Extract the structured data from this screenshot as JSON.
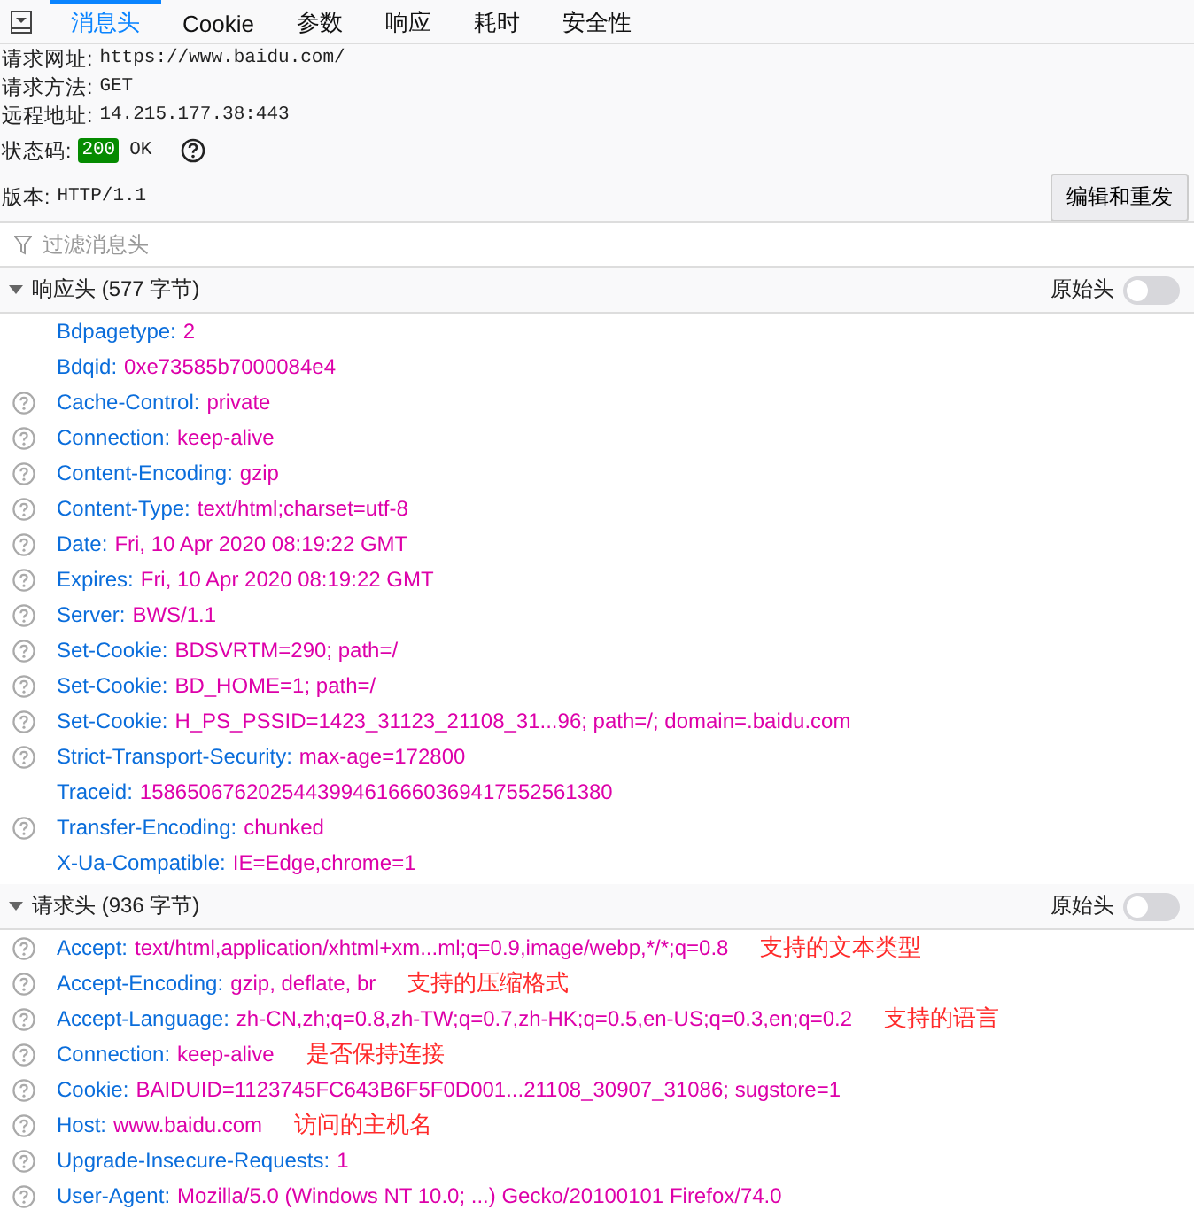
{
  "tabs": [
    {
      "label": "消息头",
      "selected": true
    },
    {
      "label": "Cookie",
      "selected": false
    },
    {
      "label": "参数",
      "selected": false
    },
    {
      "label": "响应",
      "selected": false
    },
    {
      "label": "耗时",
      "selected": false
    },
    {
      "label": "安全性",
      "selected": false
    }
  ],
  "summary": [
    {
      "label": "请求网址:",
      "value": "https://www.baidu.com/"
    },
    {
      "label": "请求方法:",
      "value": "GET"
    },
    {
      "label": "远程地址:",
      "value": "14.215.177.38:443"
    }
  ],
  "status": {
    "label": "状态码:",
    "code": "200",
    "text": "OK"
  },
  "version": {
    "label": "版本:",
    "value": "HTTP/1.1"
  },
  "resend_button": "编辑和重发",
  "filter": {
    "placeholder": "过滤消息头"
  },
  "sections": [
    {
      "title": "响应头 (577 字节)",
      "expanded": true,
      "raw_label": "原始头",
      "raw_on": false,
      "headers": [
        {
          "name": "Bdpagetype:",
          "value": "2",
          "help": false
        },
        {
          "name": "Bdqid:",
          "value": "0xe73585b7000084e4",
          "help": false
        },
        {
          "name": "Cache-Control:",
          "value": "private",
          "help": true
        },
        {
          "name": "Connection:",
          "value": "keep-alive",
          "help": true
        },
        {
          "name": "Content-Encoding:",
          "value": "gzip",
          "help": true
        },
        {
          "name": "Content-Type:",
          "value": "text/html;charset=utf-8",
          "help": true
        },
        {
          "name": "Date:",
          "value": "Fri, 10 Apr 2020 08:19:22 GMT",
          "help": true
        },
        {
          "name": "Expires:",
          "value": "Fri, 10 Apr 2020 08:19:22 GMT",
          "help": true
        },
        {
          "name": "Server:",
          "value": "BWS/1.1",
          "help": true
        },
        {
          "name": "Set-Cookie:",
          "value": "BDSVRTM=290; path=/",
          "help": true
        },
        {
          "name": "Set-Cookie:",
          "value": "BD_HOME=1; path=/",
          "help": true
        },
        {
          "name": "Set-Cookie:",
          "value": "H_PS_PSSID=1423_31123_21108_31...96; path=/; domain=.baidu.com",
          "help": true
        },
        {
          "name": "Strict-Transport-Security:",
          "value": "max-age=172800",
          "help": true
        },
        {
          "name": "Traceid:",
          "value": "1586506762025443994616660369417552561380",
          "help": false
        },
        {
          "name": "Transfer-Encoding:",
          "value": "chunked",
          "help": true
        },
        {
          "name": "X-Ua-Compatible:",
          "value": "IE=Edge,chrome=1",
          "help": false
        }
      ]
    },
    {
      "title": "请求头 (936 字节)",
      "expanded": true,
      "raw_label": "原始头",
      "raw_on": false,
      "headers": [
        {
          "name": "Accept:",
          "value": "text/html,application/xhtml+xm...ml;q=0.9,image/webp,*/*;q=0.8",
          "help": true,
          "note": "支持的文本类型"
        },
        {
          "name": "Accept-Encoding:",
          "value": "gzip, deflate, br",
          "help": true,
          "note": "支持的压缩格式"
        },
        {
          "name": "Accept-Language:",
          "value": "zh-CN,zh;q=0.8,zh-TW;q=0.7,zh-HK;q=0.5,en-US;q=0.3,en;q=0.2",
          "help": true,
          "note": "支持的语言"
        },
        {
          "name": "Connection:",
          "value": "keep-alive",
          "help": true,
          "note": "是否保持连接"
        },
        {
          "name": "Cookie:",
          "value": "BAIDUID=1123745FC643B6F5F0D001...21108_30907_31086; sugstore=1",
          "help": true
        },
        {
          "name": "Host:",
          "value": "www.baidu.com",
          "help": true,
          "note": "访问的主机名"
        },
        {
          "name": "Upgrade-Insecure-Requests:",
          "value": "1",
          "help": true
        },
        {
          "name": "User-Agent:",
          "value": "Mozilla/5.0 (Windows NT 10.0; ...) Gecko/20100101 Firefox/74.0",
          "help": true
        }
      ]
    }
  ]
}
